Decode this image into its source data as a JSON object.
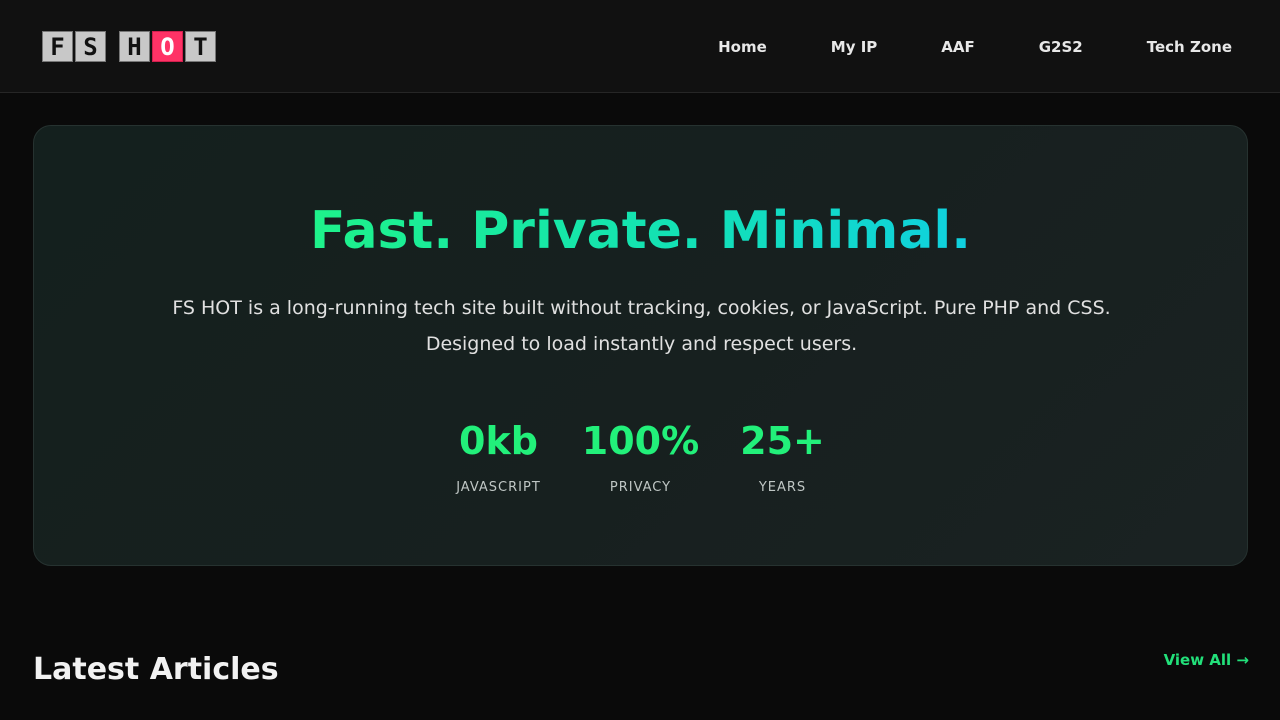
{
  "logo": {
    "letters": [
      "F",
      "S",
      "H",
      "O",
      "T"
    ],
    "accent_color": "#ff3366"
  },
  "nav": {
    "items": [
      "Home",
      "My IP",
      "AAF",
      "G2S2",
      "Tech Zone"
    ]
  },
  "hero": {
    "title": "Fast. Private. Minimal.",
    "description_line1": "FS HOT is a long-running tech site built without tracking, cookies, or JavaScript. Pure PHP and CSS.",
    "description_line2": "Designed to load instantly and respect users.",
    "stats": [
      {
        "value": "0kb",
        "label": "JAVASCRIPT"
      },
      {
        "value": "100%",
        "label": "PRIVACY"
      },
      {
        "value": "25+",
        "label": "YEARS"
      }
    ]
  },
  "latest": {
    "title": "Latest Articles",
    "view_all": "View All →"
  },
  "colors": {
    "accent_green": "#22f07a",
    "background": "#0a0a0a"
  }
}
